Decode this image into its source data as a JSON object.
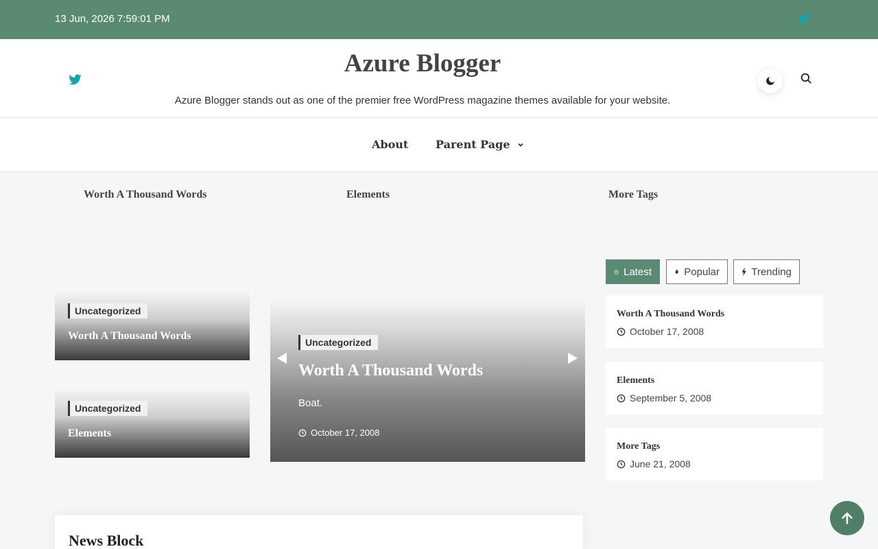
{
  "topbar": {
    "datetime": "13 Jun, 2026 7:59:01 PM",
    "social_icon": "twitter-icon"
  },
  "header": {
    "title": "Azure Blogger",
    "tagline": "Azure Blogger stands out as one of the premier free WordPress magazine themes available for your website.",
    "social_icon": "twitter-icon",
    "dark_mode_icon": "moon-icon",
    "search_icon": "search-icon"
  },
  "nav": {
    "items": [
      {
        "label": "About"
      },
      {
        "label": "Parent Page"
      }
    ]
  },
  "ticker": {
    "items": [
      "Worth A Thousand Words",
      "Elements",
      "More Tags"
    ]
  },
  "left_cards": [
    {
      "category": "Uncategorized",
      "title": "Worth A Thousand Words"
    },
    {
      "category": "Uncategorized",
      "title": "Elements"
    }
  ],
  "slider": {
    "category": "Uncategorized",
    "title": "Worth A Thousand Words",
    "excerpt": "Boat.",
    "date": "October 17, 2008"
  },
  "tabs": [
    {
      "label": "Latest"
    },
    {
      "label": "Popular"
    },
    {
      "label": "Trending"
    }
  ],
  "sidebar_posts": [
    {
      "title": "Worth A Thousand Words",
      "date": "October 17, 2008"
    },
    {
      "title": "Elements",
      "date": "September 5, 2008"
    },
    {
      "title": "More Tags",
      "date": "June 21, 2008"
    }
  ],
  "news_block": {
    "title": "News Block"
  },
  "colors": {
    "accent": "#5b8a72",
    "twitter": "#1da1a8",
    "back_to_top": "#4f7f66"
  }
}
